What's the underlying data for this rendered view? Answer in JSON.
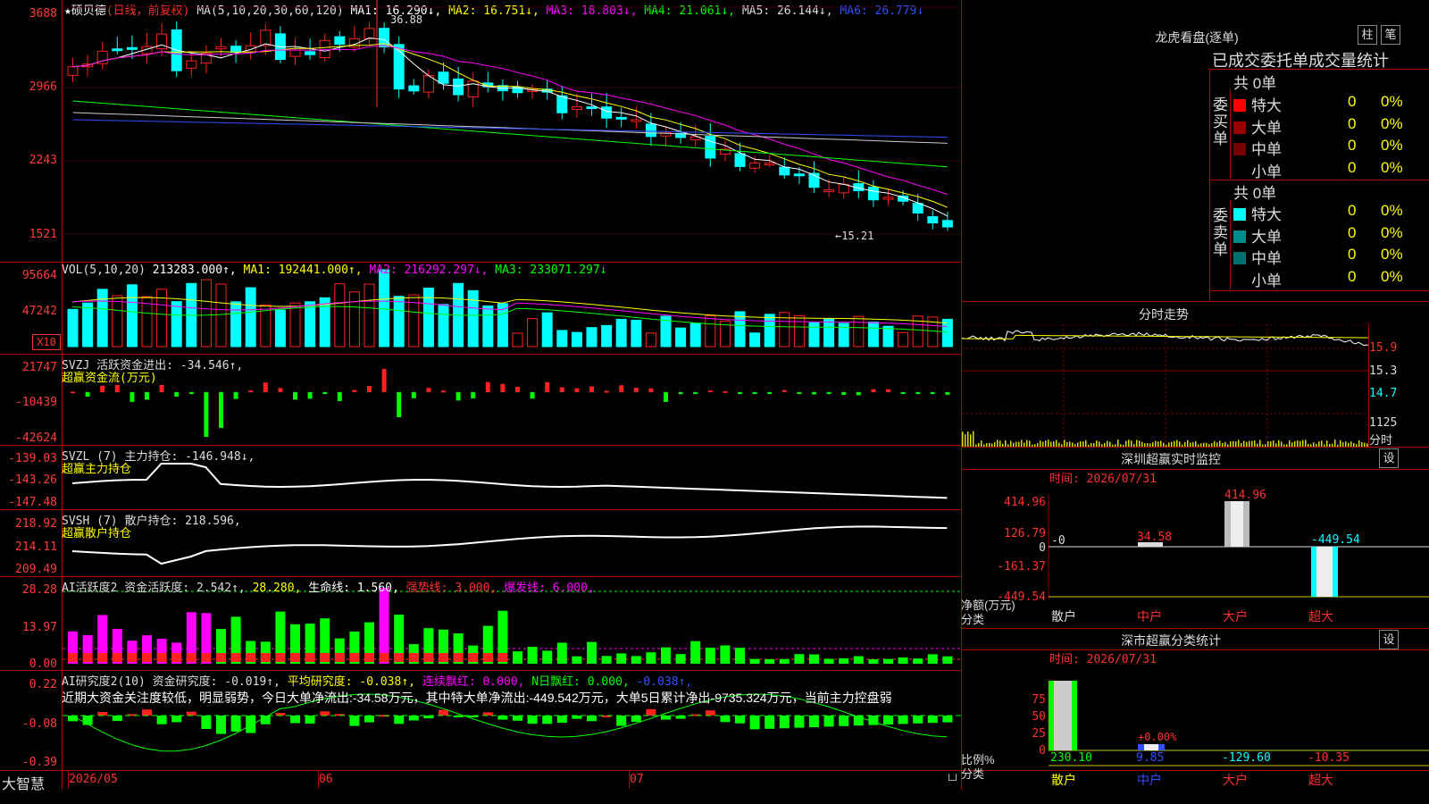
{
  "stock": {
    "star": "★",
    "name": "硕贝德",
    "mode": "(日线，前复权)"
  },
  "price_panel": {
    "ma_title": "MA(5,10,20,30,60,120)",
    "mas": [
      {
        "label": "MA1: 16.290↓,",
        "color": "#ffffff"
      },
      {
        "label": "MA2: 16.751↓,",
        "color": "#ffff00"
      },
      {
        "label": "MA3: 18.803↓,",
        "color": "#ff00ff"
      },
      {
        "label": "MA4: 21.061↓,",
        "color": "#00ff00"
      },
      {
        "label": "MA5: 26.144↓,",
        "color": "#dddddd"
      },
      {
        "label": "MA6: 26.779↓",
        "color": "#3050ff"
      }
    ],
    "y_labels": [
      "3688",
      "2966",
      "2243",
      "1521"
    ],
    "high_note": "36.88",
    "low_note": "←15.21"
  },
  "vol_panel": {
    "title": "VOL(5,10,20)",
    "value": "213283.000↑,",
    "ma1": "MA1: 192441.000↑,",
    "ma2": "MA2: 216292.297↓,",
    "ma3": "MA3: 233071.297↓",
    "y_labels": [
      "95664",
      "47242"
    ],
    "scale_badge": "X10"
  },
  "svzj_panel": {
    "title": "SVZJ  活跃资金进出: -34.546↑,",
    "subtitle": "超赢资金流(万元)",
    "y_labels": [
      "21747",
      "-10439",
      "-42624"
    ]
  },
  "svzl_panel": {
    "title": "SVZL (7) 主力持仓: -146.948↓,",
    "subtitle": "超赢主力持仓",
    "y_labels": [
      "-139.03",
      "-143.26",
      "-147.48"
    ]
  },
  "svsh_panel": {
    "title": "SVSH (7) 散户持仓: 218.596,",
    "subtitle": "超赢散户持仓",
    "y_labels": [
      "218.92",
      "214.11",
      "209.49"
    ]
  },
  "ai1_panel": {
    "title": "AI活跃度2 资金活跃度: 2.542↑,",
    "v2": "28.280,",
    "v3": "生命线: 1.560,",
    "v4": "强势线: 3.000,",
    "v5": "爆发线: 6.000,",
    "y_labels": [
      "28.28",
      "13.97",
      "0.00"
    ]
  },
  "ai2_panel": {
    "title": "AI研究度2(10) 资金研究度: -0.019↑,",
    "v2": "平均研究度: -0.038↑,",
    "v3": "连续飘红: 0.000,",
    "v4": "N日飘红: 0.000,",
    "v5": "-0.038↑,",
    "y_labels": [
      "0.22",
      "-0.08",
      "-0.39"
    ],
    "commentary": "近期大资金关注度较低，明显弱势，今日大单净流出:-34.58万元，其中特大单净流出:-449.542万元，大单5日累计净出-9735.324万元，当前主力控盘弱"
  },
  "bottom_bar": {
    "brand": "大智慧",
    "dates": [
      "2026/05",
      "06",
      "07"
    ]
  },
  "dragon_tiger": {
    "title": "龙虎看盘(逐单)",
    "btn_bar": "柱",
    "btn_tick": "笔",
    "subtitle": "已成交委托单成交量统计",
    "buy_label": "委买单",
    "sell_label": "委卖单",
    "buy_total": "共 0单",
    "sell_total": "共 0单",
    "buy_rows": [
      {
        "name": "特大",
        "count": "0",
        "pct": "0%",
        "color": "#ff0000"
      },
      {
        "name": "大单",
        "count": "0",
        "pct": "0%",
        "color": "#990000"
      },
      {
        "name": "中单",
        "count": "0",
        "pct": "0%",
        "color": "#770000"
      },
      {
        "name": "小单",
        "count": "0",
        "pct": "0%",
        "color": ""
      }
    ],
    "sell_rows": [
      {
        "name": "特大",
        "count": "0",
        "pct": "0%",
        "color": "#00ffff"
      },
      {
        "name": "大单",
        "count": "0",
        "pct": "0%",
        "color": "#008c8c"
      },
      {
        "name": "中单",
        "count": "0",
        "pct": "0%",
        "color": "#007070"
      },
      {
        "name": "小单",
        "count": "0",
        "pct": "0%",
        "color": ""
      }
    ]
  },
  "intraday": {
    "title": "分时走势",
    "y_labels": [
      "15.9",
      "15.3",
      "14.7",
      "1125"
    ],
    "tag": "分时"
  },
  "sz_monitor": {
    "title": "深圳超赢实时监控",
    "btn": "设",
    "time_label": "时间: 2026/07/31",
    "y_labels": [
      "414.96",
      "126.79",
      "0",
      "-161.37",
      "-449.54"
    ],
    "unit_label": "净额(万元)",
    "class_label": "分类",
    "bar_values": [
      "-0",
      "34.58",
      "414.96",
      "-449.54"
    ],
    "categories": [
      "散户",
      "中户",
      "大户",
      "超大"
    ]
  },
  "sz_class": {
    "title": "深市超赢分类统计",
    "btn": "设",
    "time_label": "时间: 2026/07/31",
    "y_labels": [
      "75",
      "50",
      "25",
      "0"
    ],
    "ratio_label": "比例%",
    "class_label": "分类",
    "bar_note": "+0.00%",
    "values": [
      "230.10",
      "9.85",
      "-129.60",
      "-10.35"
    ],
    "categories": [
      "散户",
      "中户",
      "大户",
      "超大"
    ]
  },
  "colors": {
    "up": "#ff2020",
    "down": "#00ffff",
    "grid": "#aa0000",
    "green": "#00ff00",
    "magenta": "#ff00ff"
  }
}
